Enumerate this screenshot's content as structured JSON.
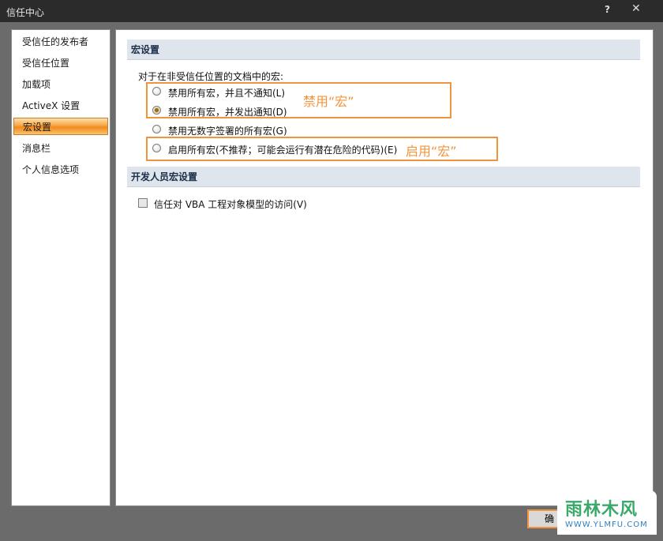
{
  "window": {
    "title": "信任中心",
    "help": "?",
    "close": "✕"
  },
  "sidebar": {
    "items": [
      {
        "label": "受信任的发布者",
        "selected": false
      },
      {
        "label": "受信任位置",
        "selected": false
      },
      {
        "label": "加载项",
        "selected": false
      },
      {
        "label": "ActiveX 设置",
        "selected": false
      },
      {
        "label": "宏设置",
        "selected": true
      },
      {
        "label": "消息栏",
        "selected": false
      },
      {
        "label": "个人信息选项",
        "selected": false
      }
    ]
  },
  "macro": {
    "heading": "宏设置",
    "prompt": "对于在非受信任位置的文档中的宏:",
    "options": [
      {
        "label": "禁用所有宏，并且不通知(L)",
        "checked": false
      },
      {
        "label": "禁用所有宏，并发出通知(D)",
        "checked": true
      },
      {
        "label": "禁用无数字签署的所有宏(G)",
        "checked": false
      },
      {
        "label": "启用所有宏(不推荐；可能会运行有潜在危险的代码)(E)",
        "checked": false
      }
    ]
  },
  "developer": {
    "heading": "开发人员宏设置",
    "vba_label": "信任对 VBA 工程对象模型的访问(V)",
    "vba_checked": false
  },
  "annotations": {
    "disable": "禁用“宏”",
    "enable": "启用“宏”",
    "color": "#f0953d"
  },
  "footer": {
    "ok_label": "确"
  },
  "watermark": {
    "main": "雨林木风",
    "sub": "WWW.YLMFU.COM"
  }
}
